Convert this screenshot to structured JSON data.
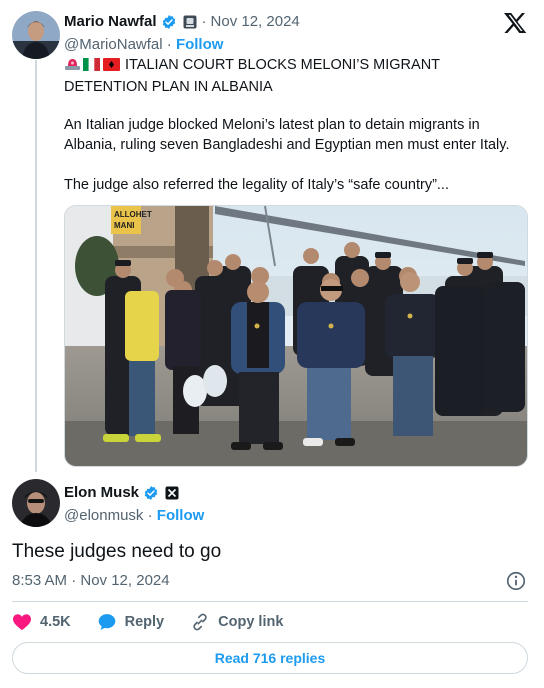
{
  "quoted_tweet": {
    "author_name": "Mario Nawfal",
    "separator": "·",
    "date": "Nov 12, 2024",
    "handle": "@MarioNawfal",
    "follow_label": "Follow",
    "headline": "ITALIAN COURT BLOCKS MELONI’S MIGRANT DETENTION PLAN IN ALBANIA",
    "paragraph1": "An Italian judge blocked Meloni’s latest plan to detain migrants in Albania, ruling seven Bangladeshi and Egyptian men must enter Italy.",
    "paragraph2": "The judge also referred the legality of Italy’s “safe country”...",
    "sign_text": "ALLOHET MANI",
    "flags": [
      "siren-emoji",
      "italy-flag",
      "albania-flag"
    ]
  },
  "main_tweet": {
    "author_name": "Elon Musk",
    "handle": "@elonmusk",
    "separator": "·",
    "follow_label": "Follow",
    "text": "These judges need to go",
    "timestamp": "8:53 AM · Nov 12, 2024"
  },
  "actions": {
    "likes": "4.5K",
    "reply_label": "Reply",
    "copy_label": "Copy link"
  },
  "read_replies_label": "Read 716 replies",
  "colors": {
    "accent": "#1d9bf0",
    "like": "#f91880",
    "text": "#0f1419",
    "muted": "#536471",
    "border": "#cfd9de"
  }
}
